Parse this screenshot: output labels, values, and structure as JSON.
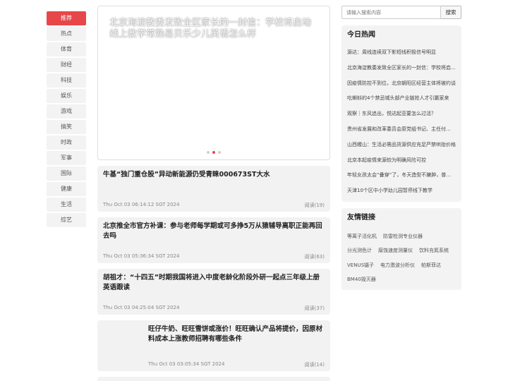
{
  "nav": {
    "items": [
      "推荐",
      "热点",
      "体育",
      "财经",
      "科技",
      "娱乐",
      "游戏",
      "搞笑",
      "时政",
      "军事",
      "国际",
      "健康",
      "生活",
      "综艺"
    ],
    "active_index": 0
  },
  "carousel": {
    "title": "北京海淀教委发致全区家长的一封信：学校将启动线上教学常熟易贝乐少儿英语怎么样",
    "slide_count": 3,
    "active_slide": 2
  },
  "articles": [
    {
      "title": "牛基“独门重仓股”异动新能源仍受青睐000673ST大水",
      "time": "Thu Oct 03 06:14:12 SGT 2024",
      "reads": "阅读(19)"
    },
    {
      "title": "北京推全市官方补课：参与老师每学期或可多挣5万从猿辅导离职正能再回去吗",
      "time": "Thu Oct 03 05:36:34 SGT 2024",
      "reads": "阅读(63)"
    },
    {
      "title": "胡祖才：“十四五”时期我国将进入中度老龄化阶段外研一起点三年级上册英语跟读",
      "time": "Thu Oct 03 04:25:04 SGT 2024",
      "reads": "阅读(37)"
    },
    {
      "title": "旺仔牛奶、旺旺雪饼或涨价！旺旺确认产品将提价，因原材料成本上涨教师招聘有哪些条件",
      "time": "Thu Oct 03 03:05:34 SGT 2024",
      "reads": "阅读(14)"
    }
  ],
  "search": {
    "placeholder": "请输入搜索内容",
    "button_label": "搜索"
  },
  "hot": {
    "title": "今日热闻",
    "items": [
      "源达：周线连续双下影短线积极信号明显",
      "北京海淀教委发致全区家长的一封信：学校将启动线上教学",
      "因疫情防控不到位，北京朝阳区经营主体将被约谈",
      "吃蝌蚪的4个禁忌城头部产业链抢人才引赢家来",
      "观察｜东风追出，悦达起亚要怎么过活？",
      "贵州省发展和改革委员会原党组书记、主任付...",
      "山西稷山：生活必需品货源供应充足严禁哄抬价格",
      "北京本起疫情来源较为明确风险可控",
      "年轻女孩太会“叠穿”了，冬天造型不臃肿，普通人也能学",
      "天津10个区中小学幼儿园暂停线下教学"
    ]
  },
  "links": {
    "title": "友情链接",
    "items": [
      "等离子活化机",
      "防雷检测专业仪器",
      "分光测色计",
      "腐蚀速度测量仪",
      "饮料充氮系统",
      "VENUS镊子",
      "电力激波分析仪",
      "帕斯菲达",
      "BM40毁灭器"
    ]
  },
  "colors": {
    "accent": "#e8474a",
    "card_bg": "#f2f2f2",
    "panel_bg": "#f3f3f3"
  }
}
